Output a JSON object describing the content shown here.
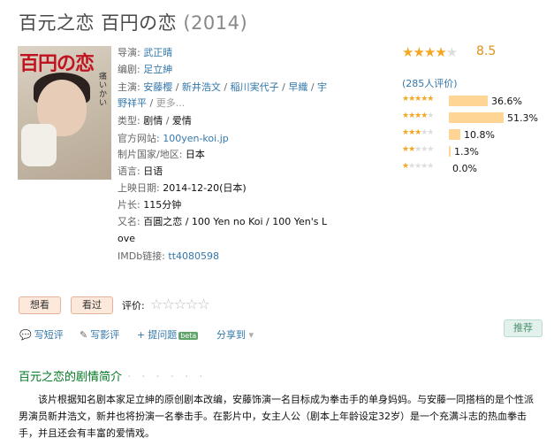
{
  "title": {
    "main": "百元之恋 百円の恋",
    "year": "(2014)"
  },
  "info": {
    "director_label": "导演:",
    "director": "武正晴",
    "writer_label": "编剧:",
    "writer": "足立紳",
    "cast_label": "主演:",
    "cast": [
      "安藤樱",
      "新井浩文",
      "稲川実代子",
      "早織",
      "宇"
    ],
    "cast_line2_first": "野祥平",
    "more": "更多...",
    "genre_label": "类型:",
    "genres": [
      "剧情",
      "爱情"
    ],
    "site_label": "官方网站:",
    "site": "100yen-koi.jp",
    "country_label": "制片国家/地区:",
    "country": "日本",
    "language_label": "语言:",
    "language": "日语",
    "release_label": "上映日期:",
    "release": "2014-12-20(日本)",
    "runtime_label": "片长:",
    "runtime": "115分钟",
    "aka_label": "又名:",
    "aka_line1": "百圓之恋 / 100 Yen no Koi / 100 Yen's L",
    "aka_line2": "ove",
    "imdb_label": "IMDb链接:",
    "imdb": "tt4080598"
  },
  "poster": {
    "title_text": "百円の恋",
    "side_text": "痛いかい"
  },
  "rating": {
    "score": "8.5",
    "stars_filled": 4.5,
    "count": "(285人评价)",
    "breakdown": [
      {
        "stars": 5,
        "fraction": 0.366,
        "pct": "36.6%"
      },
      {
        "stars": 4,
        "fraction": 0.513,
        "pct": "51.3%"
      },
      {
        "stars": 3,
        "fraction": 0.108,
        "pct": "10.8%"
      },
      {
        "stars": 2,
        "fraction": 0.013,
        "pct": "1.3%"
      },
      {
        "stars": 1,
        "fraction": 0.0,
        "pct": "0.0%"
      }
    ]
  },
  "actions": {
    "want": "想看",
    "seen": "看过",
    "rate_label": "评价:",
    "write_review_short": "写短评",
    "write_review": "写影评",
    "ask": "提问题",
    "beta": "beta",
    "share": "分享到",
    "recommend": "推荐"
  },
  "summary": {
    "heading": "百元之恋的剧情简介",
    "dots": "· · · · · ·",
    "text": "该片根据知名剧本家足立紳的原创剧本改编，安藤饰演一名目标成为拳击手的单身妈妈。与安藤一同搭档的是个性派男演员新井浩文，新井也将扮演一名拳击手。在影片中，女主人公（剧本上年龄设定32岁）是一个充满斗志的热血拳击手，并且还会有丰富的爱情戏。"
  },
  "colors": {
    "link": "#3377aa",
    "star": "#f5a623",
    "bar": "#ffd596",
    "summary_heading": "#007722"
  }
}
